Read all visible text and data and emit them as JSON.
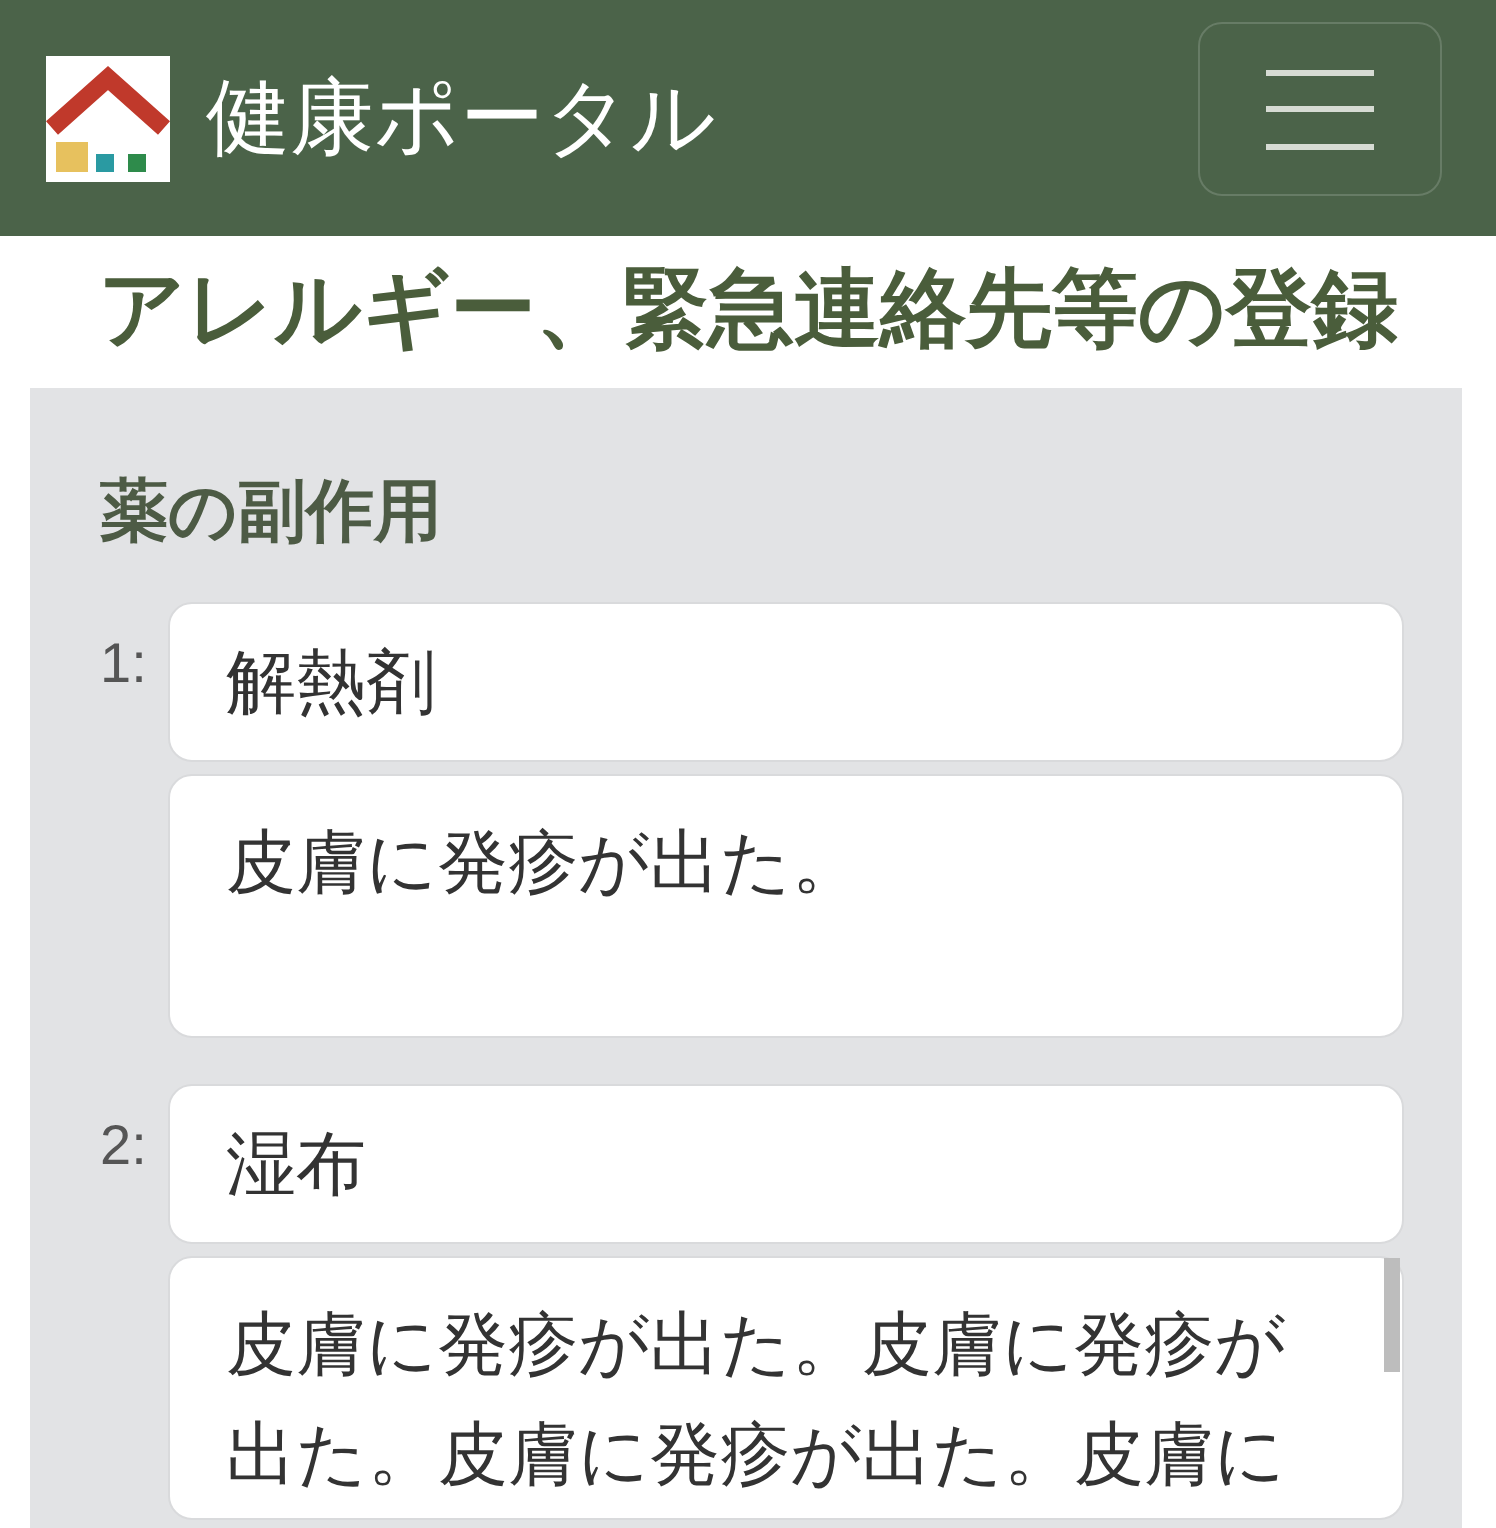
{
  "header": {
    "title": "健康ポータル"
  },
  "page": {
    "heading": "アレルギー、緊急連絡先等の登録"
  },
  "section": {
    "heading": "薬の副作用",
    "entries": [
      {
        "number": "1:",
        "medicine": "解熱剤",
        "reaction": "皮膚に発疹が出た。"
      },
      {
        "number": "2:",
        "medicine": "湿布",
        "reaction": "皮膚に発疹が出た。皮膚に発疹が出た。皮膚に発疹が出た。皮膚に"
      }
    ]
  }
}
